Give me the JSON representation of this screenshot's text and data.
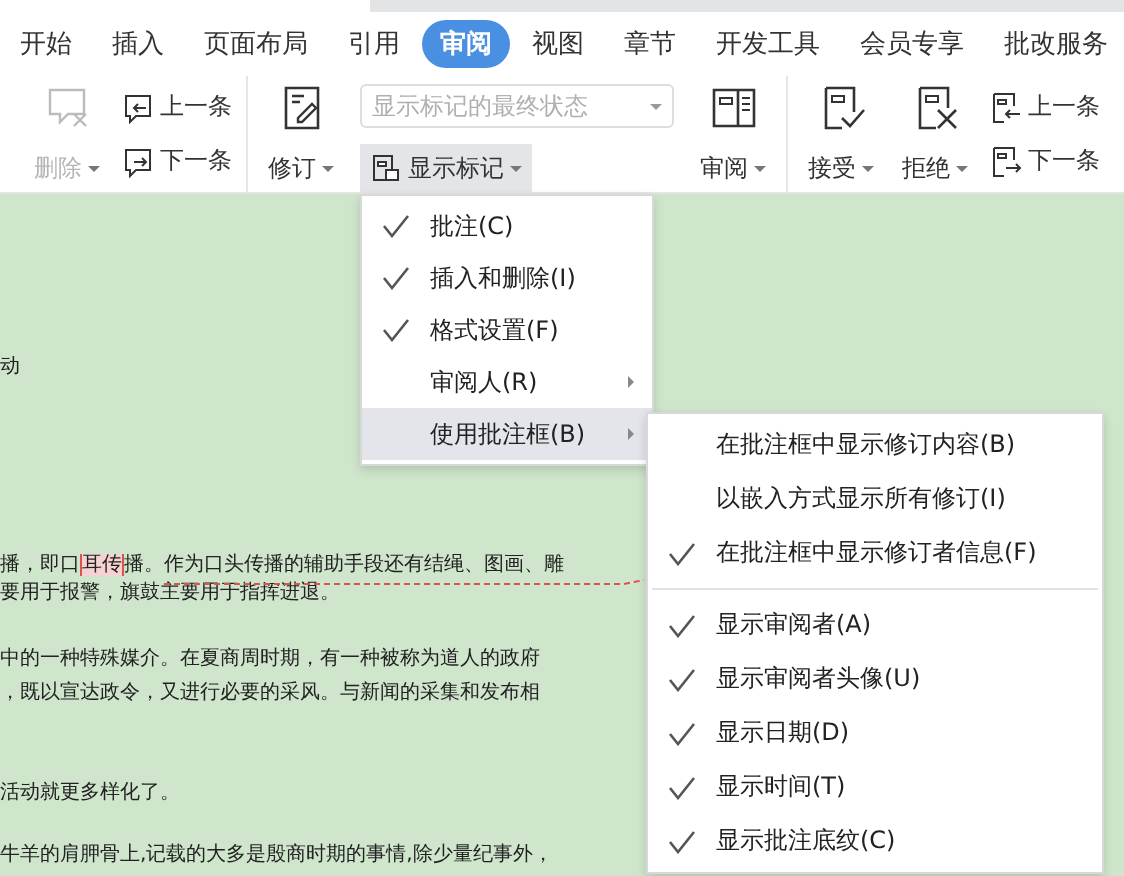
{
  "tabs": [
    {
      "label": "开始",
      "selected": false
    },
    {
      "label": "插入",
      "selected": false
    },
    {
      "label": "页面布局",
      "selected": false
    },
    {
      "label": "引用",
      "selected": false
    },
    {
      "label": "审阅",
      "selected": true
    },
    {
      "label": "视图",
      "selected": false
    },
    {
      "label": "章节",
      "selected": false
    },
    {
      "label": "开发工具",
      "selected": false
    },
    {
      "label": "会员专享",
      "selected": false
    },
    {
      "label": "批改服务",
      "selected": false
    }
  ],
  "ribbon": {
    "delete": {
      "label": "删除",
      "disabled": true
    },
    "prev": "上一条",
    "next": "下一条",
    "track": "修订",
    "display_dropdown": {
      "value": "显示标记的最终状态",
      "disabled": true
    },
    "show_markup": {
      "label": "显示标记",
      "selected": true
    },
    "review": "审阅",
    "accept": "接受",
    "reject": "拒绝",
    "prev2": "上一条",
    "next2": "下一条"
  },
  "document": {
    "paragraphs": [
      [
        {
          "parts": [
            "动"
          ]
        }
      ],
      [
        {
          "parts": [
            "播，即口",
            "耳传",
            "播。作为口头传播的辅助手段还有结绳、图画、雕"
          ]
        },
        {
          "parts": [
            "要用于报警，旗鼓主要用于指挥进退。"
          ]
        }
      ],
      [
        {
          "parts": [
            "中的一种特殊媒介。在夏商周时期，有一种被称为道人的政府"
          ]
        },
        {
          "parts": [
            "，既以宣达政令，又进行必要的采风。与新闻的采集和发布相"
          ]
        }
      ],
      [
        {
          "parts": [
            "活动就更多样化了。"
          ]
        }
      ],
      [
        {
          "parts": [
            "牛羊的肩胛骨上,记载的大多是殷商时期的事情,除少量纪事外，"
          ]
        }
      ]
    ]
  },
  "menu": {
    "items": [
      {
        "label": "批注(C)",
        "checked": true,
        "submenu": false,
        "selected": false
      },
      {
        "label": "插入和删除(I)",
        "checked": true,
        "submenu": false,
        "selected": false
      },
      {
        "label": "格式设置(F)",
        "checked": true,
        "submenu": false,
        "selected": false
      },
      {
        "label": "审阅人(R)",
        "checked": false,
        "submenu": true,
        "selected": false
      },
      {
        "label": "使用批注框(B)",
        "checked": false,
        "submenu": true,
        "selected": true
      }
    ]
  },
  "submenu": {
    "groups": [
      [
        {
          "label": "在批注框中显示修订内容(B)",
          "checked": false
        },
        {
          "label": "以嵌入方式显示所有修订(I)",
          "checked": false
        },
        {
          "label": "在批注框中显示修订者信息(F)",
          "checked": true
        }
      ],
      [
        {
          "label": "显示审阅者(A)",
          "checked": true
        },
        {
          "label": "显示审阅者头像(U)",
          "checked": true
        },
        {
          "label": "显示日期(D)",
          "checked": true
        },
        {
          "label": "显示时间(T)",
          "checked": true
        },
        {
          "label": "显示批注底纹(C)",
          "checked": true
        }
      ]
    ]
  }
}
